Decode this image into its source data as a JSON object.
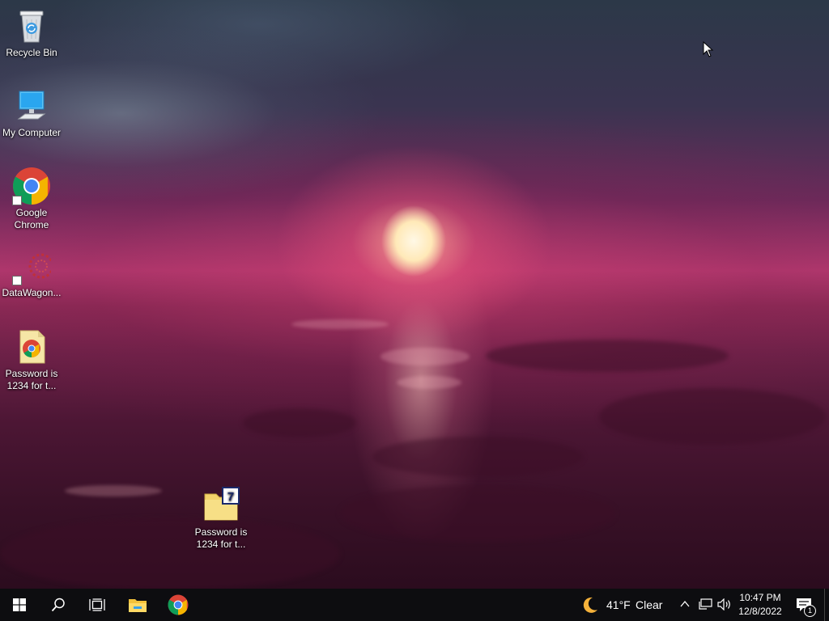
{
  "desktop": {
    "icons": [
      {
        "label": "Recycle Bin"
      },
      {
        "label": "My Computer"
      },
      {
        "label": "Google Chrome"
      },
      {
        "label": "DataWagon..."
      },
      {
        "label": "Password is 1234 for t..."
      },
      {
        "label": "Password is 1234 for t..."
      }
    ]
  },
  "taskbar": {
    "weather": {
      "temperature": "41°F",
      "condition": "Clear"
    },
    "clock": {
      "time": "10:47 PM",
      "date": "12/8/2022"
    },
    "notification_count": "1"
  },
  "colors": {
    "taskbar_bg": "#0d0d10",
    "windows_blue": "#ffffff",
    "folder_yellow": "#f3d36b"
  }
}
